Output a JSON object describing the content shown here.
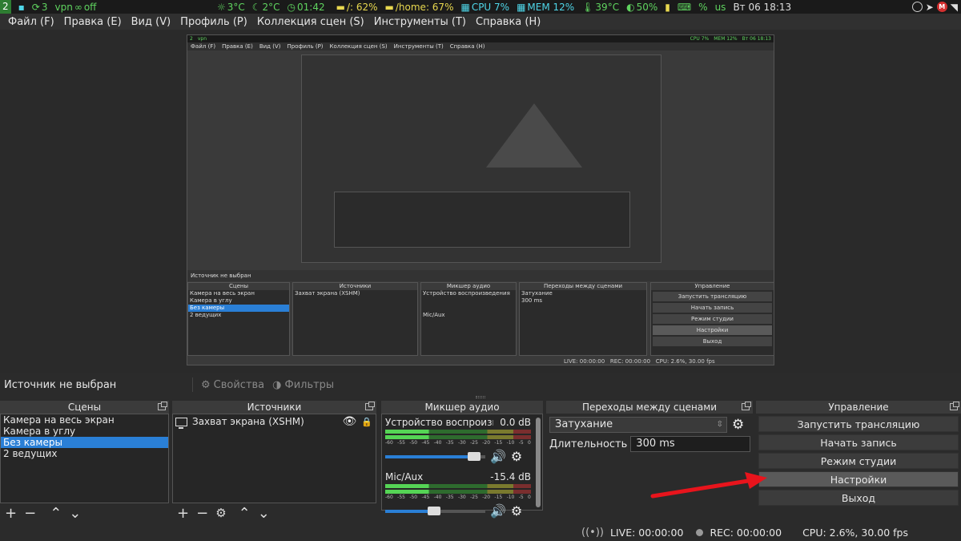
{
  "topbar": {
    "workspace": "2",
    "updates": "3",
    "vpn": "vpn",
    "vpn_state": "off",
    "weather1": "3°C",
    "weather2": "2°C",
    "clock1": "01:42",
    "disk_root": "/: 62%",
    "disk_home": "/home: 67%",
    "cpu": "CPU 7%",
    "mem": "MEM 12%",
    "temp": "39°C",
    "battery": "50%",
    "pct": "%",
    "us": "us",
    "datetime": "Вт 06 18:13"
  },
  "menubar": {
    "items": [
      "Файл (F)",
      "Правка (E)",
      "Вид (V)",
      "Профиль (P)",
      "Коллекция сцен (S)",
      "Инструменты (T)",
      "Справка (H)"
    ]
  },
  "sourcebar": {
    "title": "Источник не выбран",
    "properties": "Свойства",
    "filters": "Фильтры"
  },
  "scenes": {
    "title": "Сцены",
    "items": [
      "Камера на весь экран",
      "Камера в углу",
      "Без камеры",
      "2 ведущих"
    ],
    "selected_index": 2
  },
  "sources": {
    "title": "Источники",
    "items": [
      "Захват экрана (XSHM)"
    ]
  },
  "mixer": {
    "title": "Микшер аудио",
    "channels": [
      {
        "name": "Устройство воспроизведения",
        "db": "0.0 dB",
        "fader": 0.95
      },
      {
        "name": "Mic/Aux",
        "db": "-15.4 dB",
        "fader": 0.55
      }
    ],
    "ticks": [
      "-60",
      "-55",
      "-50",
      "-45",
      "-40",
      "-35",
      "-30",
      "-25",
      "-20",
      "-15",
      "-10",
      "-5",
      "0"
    ]
  },
  "transitions": {
    "title": "Переходы между сценами",
    "selected": "Затухание",
    "duration_label": "Длительность",
    "duration_value": "300 ms"
  },
  "controls": {
    "title": "Управление",
    "buttons": [
      "Запустить трансляцию",
      "Начать запись",
      "Режим студии",
      "Настройки",
      "Выход"
    ],
    "highlighted_index": 3
  },
  "status": {
    "live": "LIVE: 00:00:00",
    "rec": "REC: 00:00:00",
    "cpu": "CPU: 2.6%, 30.00 fps"
  },
  "colors": {
    "accent": "#2a7fd6",
    "arrow": "#e8141c"
  }
}
